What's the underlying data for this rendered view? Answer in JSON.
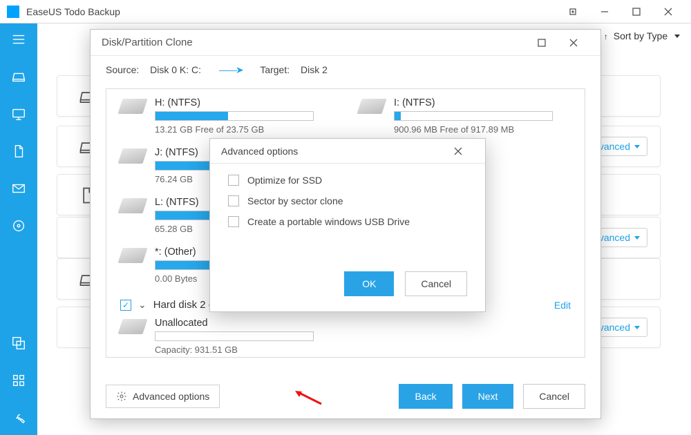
{
  "app": {
    "title": "EaseUS Todo Backup"
  },
  "toolbar": {
    "sort_by": "Sort by Type"
  },
  "cards": {
    "advanced_label": "Advanced"
  },
  "clone_dialog": {
    "title": "Disk/Partition Clone",
    "source_label": "Source:",
    "source_value": "Disk 0 K: C:",
    "target_label": "Target:",
    "target_value": "Disk 2",
    "partitions": [
      {
        "name": "H: (NTFS)",
        "free": "13.21 GB Free of 23.75 GB",
        "fill": 46
      },
      {
        "name": "I: (NTFS)",
        "free": "900.96 MB Free of 917.89 MB",
        "fill": 4
      },
      {
        "name": "J: (NTFS)",
        "free": "76.24 GB",
        "fill": 100
      },
      {
        "name": "L: (NTFS)",
        "free": "65.28 GB",
        "fill": 100
      },
      {
        "name": "*: (Other)",
        "free": "0.00 Bytes",
        "fill": 100
      }
    ],
    "target_disk": {
      "label": "Hard disk 2 (931.…",
      "edit": "Edit"
    },
    "unallocated": {
      "name": "Unallocated",
      "capacity": "Capacity: 931.51 GB"
    },
    "advanced_link": "Advanced options",
    "back": "Back",
    "next": "Next",
    "cancel": "Cancel"
  },
  "adv_popup": {
    "title": "Advanced options",
    "opt1": "Optimize for SSD",
    "opt2": "Sector by sector clone",
    "opt3": "Create a portable windows USB Drive",
    "ok": "OK",
    "cancel": "Cancel"
  }
}
